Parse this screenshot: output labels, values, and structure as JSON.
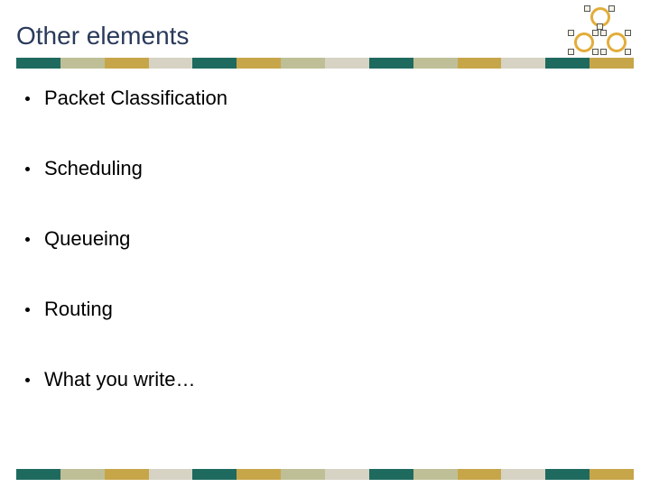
{
  "title": "Other elements",
  "bullets": [
    "Packet Classification",
    "Scheduling",
    "Queueing",
    "Routing",
    "What you write…"
  ],
  "stripe_colors": [
    "#1f6a5f",
    "#bfbf97",
    "#c7a64a",
    "#d6d3c4",
    "#1f6a5f",
    "#c7a64a",
    "#bfbf97",
    "#d6d3c4",
    "#1f6a5f",
    "#bfbf97",
    "#c7a64a",
    "#d6d3c4",
    "#1f6a5f",
    "#c7a64a"
  ]
}
